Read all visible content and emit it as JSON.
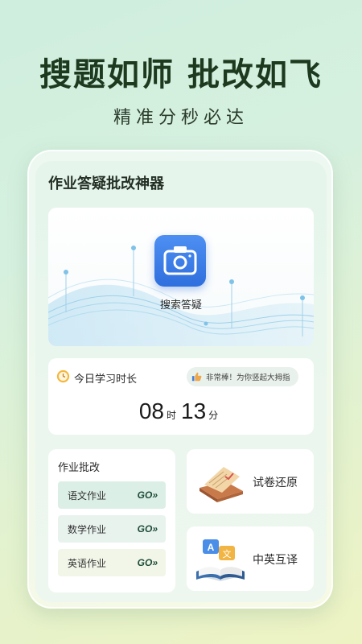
{
  "promo": {
    "headline": "搜题如师 批改如飞",
    "subline": "精准分秒必达"
  },
  "app": {
    "title": "作业答疑批改神器",
    "search": {
      "label": "搜索答疑",
      "icon": "camera-icon"
    },
    "study_time": {
      "label": "今日学习时长",
      "praise": "非常棒！为你竖起大拇指",
      "hours": "08",
      "hours_unit": "时",
      "minutes": "13",
      "minutes_unit": "分"
    },
    "homework": {
      "title": "作业批改",
      "items": [
        {
          "label": "语文作业",
          "go": "GO»",
          "bg": "#dcefe6"
        },
        {
          "label": "数学作业",
          "go": "GO»",
          "bg": "#e8f3ee"
        },
        {
          "label": "英语作业",
          "go": "GO»",
          "bg": "#f1f6e8"
        }
      ]
    },
    "features": [
      {
        "label": "试卷还原",
        "icon": "test-paper-icon"
      },
      {
        "label": "中英互译",
        "icon": "translate-book-icon"
      }
    ]
  },
  "colors": {
    "accent_blue": "#2f6fde",
    "headline": "#1d3a1f",
    "go_text": "#1f4d3a"
  }
}
